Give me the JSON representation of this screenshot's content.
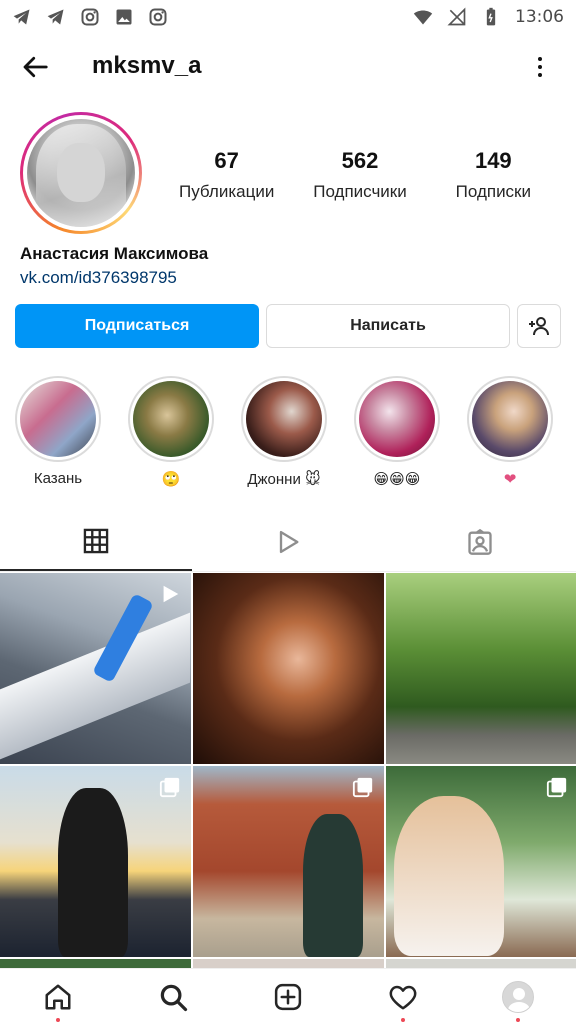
{
  "status_bar": {
    "time": "13:06",
    "left_icons": [
      "telegram-icon",
      "telegram-icon",
      "instagram-icon",
      "gallery-icon",
      "instagram-icon"
    ],
    "right_icons": [
      "wifi-icon",
      "no-signal-icon",
      "battery-icon"
    ]
  },
  "header": {
    "username": "mksmv_a",
    "back_icon": "arrow-left-icon",
    "more_icon": "more-vertical-icon"
  },
  "profile": {
    "stats": [
      {
        "count": "67",
        "label": "Публикации"
      },
      {
        "count": "562",
        "label": "Подписчики"
      },
      {
        "count": "149",
        "label": "Подписки"
      }
    ],
    "full_name": "Анастасия Максимова",
    "link": "vk.com/id376398795"
  },
  "actions": {
    "follow_label": "Подписаться",
    "message_label": "Написать",
    "add_user_icon": "add-user-icon"
  },
  "highlights": [
    {
      "label": "Казань"
    },
    {
      "label": "🙄"
    },
    {
      "label": "Джонни 🐭"
    },
    {
      "label": "😁😁😁"
    },
    {
      "label": "❤"
    }
  ],
  "tabs": [
    "grid-icon",
    "reels-icon",
    "tagged-icon"
  ],
  "bottom_nav": [
    "home-icon",
    "search-icon",
    "new-post-icon",
    "heart-icon",
    "profile-avatar"
  ],
  "colors": {
    "accent": "#0095f6",
    "link": "#00376b",
    "notification_dot": "#ed4956"
  }
}
